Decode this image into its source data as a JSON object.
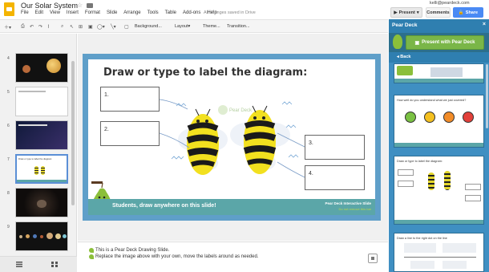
{
  "app": {
    "title": "Our Solar System",
    "menu": [
      "File",
      "Edit",
      "View",
      "Insert",
      "Format",
      "Slide",
      "Arrange",
      "Tools",
      "Table",
      "Add-ons",
      "Help"
    ],
    "save_status": "All changes saved in Drive",
    "account": "kelli@peardeck.com",
    "present_label": "Present",
    "comments_label": "Comments",
    "share_label": "Share"
  },
  "toolbar": {
    "background_label": "Background...",
    "layout_label": "Layout",
    "theme_label": "Theme...",
    "transition_label": "Transition..."
  },
  "filmstrip": {
    "slides": [
      {
        "num": "4",
        "kind": "planets"
      },
      {
        "num": "5",
        "kind": "text",
        "text": ""
      },
      {
        "num": "6",
        "kind": "dark"
      },
      {
        "num": "7",
        "kind": "drawing",
        "active": true,
        "text": "Draw or type to label the diagram:"
      },
      {
        "num": "8",
        "kind": "asteroid"
      },
      {
        "num": "9",
        "kind": "planets-row"
      }
    ]
  },
  "slide": {
    "title": "Draw or type to label the diagram:",
    "labels": [
      "1.",
      "2.",
      "3.",
      "4."
    ],
    "watermark": "Pear Deck",
    "footer_text": "Students, draw anywhere on this slide!",
    "footer_right_1": "Pear Deck Interactive Slide",
    "footer_right_2": "Do not remove this bar"
  },
  "notes": {
    "line1": "This is a Pear Deck Drawing Slide.",
    "line2": "Replace the image above with your own, move the labels around as needed."
  },
  "peardeck": {
    "header": "Pear Deck",
    "close": "×",
    "present_button": "Present with Pear Deck",
    "back": "Back",
    "cards": [
      {
        "title": "",
        "kind": "top"
      },
      {
        "title": "How well do you understand what we just covered?",
        "kind": "faces"
      },
      {
        "title": "Draw or type to label the diagram:",
        "kind": "drawing"
      },
      {
        "title": "Draw a line to the right dot on the line",
        "kind": "line"
      }
    ]
  },
  "colors": {
    "accent_blue": "#4a8af4",
    "slide_border": "#5f9fc9",
    "pd_blue": "#3f8fc2",
    "pd_green": "#7ab648",
    "teal_footer": "#5ba6a8"
  }
}
